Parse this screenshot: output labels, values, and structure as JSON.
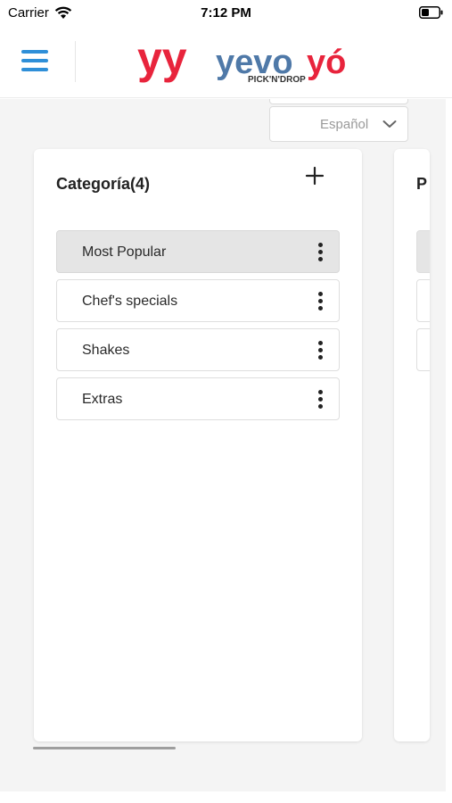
{
  "status_bar": {
    "carrier": "Carrier",
    "time": "7:12 PM"
  },
  "header": {
    "logo_mark": "yy",
    "logo_word_left": "yevo",
    "logo_word_right": "yó",
    "logo_tagline": "PICK'N'DROP",
    "colors": {
      "blue": "#2f8fd8",
      "red": "#e8243c",
      "slate": "#4f79a8"
    }
  },
  "language_select": {
    "selected": "Español"
  },
  "categories_panel": {
    "title": "Categoría(4)",
    "items": [
      {
        "label": "Most Popular",
        "active": true
      },
      {
        "label": "Chef's specials",
        "active": false
      },
      {
        "label": "Shakes",
        "active": false
      },
      {
        "label": "Extras",
        "active": false
      }
    ]
  },
  "side_panel": {
    "title_fragment": "P"
  },
  "icons": {
    "menu": "hamburger-menu-icon",
    "add": "plus-icon",
    "more": "more-vertical-icon",
    "chevron": "chevron-down-icon"
  }
}
